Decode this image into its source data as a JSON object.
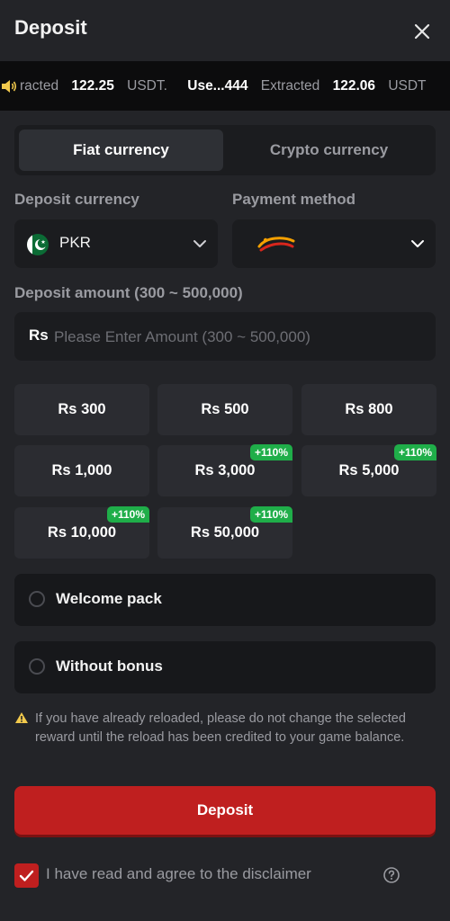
{
  "header": {
    "title": "Deposit"
  },
  "ticker": [
    {
      "text": "racted",
      "style": "dim"
    },
    {
      "text": "122.25",
      "style": "bold"
    },
    {
      "text": "USDT.",
      "style": "dim"
    },
    {
      "text": "Use...444",
      "style": "bold"
    },
    {
      "text": "Extracted",
      "style": "dim"
    },
    {
      "text": "122.06",
      "style": "bold"
    },
    {
      "text": "USDT",
      "style": "dim"
    }
  ],
  "tabs": {
    "fiat": "Fiat currency",
    "crypto": "Crypto currency",
    "active": "fiat"
  },
  "deposit_currency": {
    "label": "Deposit currency",
    "value": "PKR"
  },
  "payment_method": {
    "label": "Payment method",
    "value": "JazzCash"
  },
  "amount": {
    "label": "Deposit amount (300 ~ 500,000)",
    "prefix": "Rs",
    "placeholder": "Please Enter Amount (300 ~ 500,000)"
  },
  "presets": [
    {
      "label": "Rs 300",
      "badge": ""
    },
    {
      "label": "Rs 500",
      "badge": ""
    },
    {
      "label": "Rs 800",
      "badge": ""
    },
    {
      "label": "Rs 1,000",
      "badge": ""
    },
    {
      "label": "Rs 3,000",
      "badge": "+110%"
    },
    {
      "label": "Rs 5,000",
      "badge": "+110%"
    },
    {
      "label": "Rs 10,000",
      "badge": "+110%"
    },
    {
      "label": "Rs 50,000",
      "badge": "+110%"
    }
  ],
  "bonus_options": [
    {
      "label": "Welcome pack",
      "selected": false
    },
    {
      "label": "Without bonus",
      "selected": false
    }
  ],
  "warning": "If you have already reloaded, please do not change the selected reward until the reload has been credited to your game balance.",
  "deposit_button": "Deposit",
  "disclaimer": {
    "text": "I have read and agree to the disclaimer",
    "checked": true
  },
  "colors": {
    "accent": "#bf1f1f",
    "badge": "#1fae49",
    "background": "#232428",
    "panel": "#1b1c1f"
  }
}
